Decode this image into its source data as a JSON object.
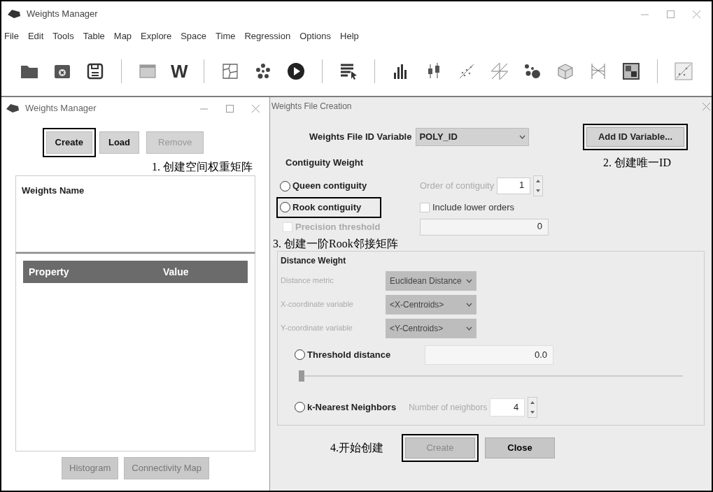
{
  "window": {
    "title": "Weights Manager"
  },
  "menu": [
    "File",
    "Edit",
    "Tools",
    "Table",
    "Map",
    "Explore",
    "Space",
    "Time",
    "Regression",
    "Options",
    "Help"
  ],
  "toolbar": [
    {
      "kind": "folder"
    },
    {
      "kind": "close-folder"
    },
    {
      "kind": "save"
    },
    {
      "kind": "separator"
    },
    {
      "kind": "table"
    },
    {
      "kind": "text",
      "label": "W"
    },
    {
      "kind": "separator"
    },
    {
      "kind": "map"
    },
    {
      "kind": "cluster"
    },
    {
      "kind": "play"
    },
    {
      "kind": "separator"
    },
    {
      "kind": "select"
    },
    {
      "kind": "separator"
    },
    {
      "kind": "histogram"
    },
    {
      "kind": "boxplot"
    },
    {
      "kind": "scatter"
    },
    {
      "kind": "scatter-matrix"
    },
    {
      "kind": "bubble"
    },
    {
      "kind": "cube"
    },
    {
      "kind": "parallel"
    },
    {
      "kind": "heatmap"
    },
    {
      "kind": "separator"
    },
    {
      "kind": "moran"
    }
  ],
  "left_panel": {
    "title": "Weights Manager",
    "buttons": [
      {
        "label": "Create",
        "disabled": false,
        "highlighted": true
      },
      {
        "label": "Load",
        "disabled": false,
        "highlighted": false
      },
      {
        "label": "Remove",
        "disabled": true,
        "highlighted": false
      }
    ],
    "annotation": "1. 创建空间权重矩阵",
    "list_header": "Weights Name",
    "columns": [
      "Property",
      "Value"
    ],
    "bottom_buttons": [
      {
        "label": "Histogram",
        "disabled": true
      },
      {
        "label": "Connectivity Map",
        "disabled": true
      }
    ]
  },
  "dialog": {
    "title": "Weights File Creation",
    "id_variable": {
      "label": "Weights File ID Variable",
      "value": "POLY_ID"
    },
    "add_button": {
      "label": "Add ID Variable...",
      "highlighted": true
    },
    "annotation_2": "2. 创建唯一ID",
    "contiguity": {
      "title": "Contiguity Weight",
      "options": [
        {
          "label": "Queen contiguity",
          "selected": false,
          "highlighted": false
        },
        {
          "label": "Rook contiguity",
          "selected": false,
          "highlighted": true
        }
      ],
      "order": {
        "label": "Order of contiguity",
        "value": "1",
        "disabled": true
      },
      "include_lower": {
        "label": "Include lower orders",
        "checked": false,
        "disabled": false
      },
      "precision": {
        "label": "Precision threshold",
        "checked": false,
        "disabled": true,
        "value": "0"
      }
    },
    "annotation_3": "3. 创建一阶Rook邻接矩阵",
    "distance": {
      "title": "Distance Weight",
      "fields": [
        {
          "label": "Distance metric",
          "value": "Euclidean Distance"
        },
        {
          "label": "X-coordinate variable",
          "value": "<X-Centroids>"
        },
        {
          "label": "Y-coordinate variable",
          "value": "<Y-Centroids>"
        }
      ],
      "threshold": {
        "label": "Threshold distance",
        "selected": false,
        "value": "0.0",
        "level": 0
      },
      "knn": {
        "label": "k-Nearest Neighbors",
        "selected": false,
        "neighbors_label": "Number of neighbors",
        "value": "4"
      }
    },
    "annotation_4": "4.开始创建",
    "buttons": [
      {
        "label": "Create",
        "disabled": true,
        "highlighted": true
      },
      {
        "label": "Close",
        "disabled": false,
        "highlighted": false
      }
    ]
  }
}
